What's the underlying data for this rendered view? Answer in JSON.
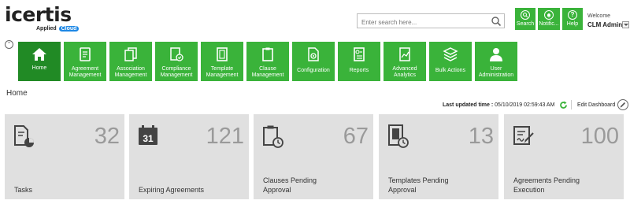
{
  "brand": {
    "name": "icertis",
    "tagline": "Applied",
    "cloud": "Cloud"
  },
  "search": {
    "placeholder": "Enter search here..."
  },
  "top_buttons": [
    {
      "label": "Search"
    },
    {
      "label": "Notific..."
    },
    {
      "label": "Help"
    }
  ],
  "user": {
    "welcome": "Welcome",
    "name": "CLM Admin"
  },
  "nav": [
    {
      "label1": "Home",
      "label2": ""
    },
    {
      "label1": "Agreement",
      "label2": "Management"
    },
    {
      "label1": "Association",
      "label2": "Management"
    },
    {
      "label1": "Compliance",
      "label2": "Management"
    },
    {
      "label1": "Template",
      "label2": "Management"
    },
    {
      "label1": "Clause",
      "label2": "Management"
    },
    {
      "label1": "Configuration",
      "label2": ""
    },
    {
      "label1": "Reports",
      "label2": ""
    },
    {
      "label1": "Advanced",
      "label2": "Analytics"
    },
    {
      "label1": "Bulk Actions",
      "label2": ""
    },
    {
      "label1": "User",
      "label2": "Administration"
    }
  ],
  "page": {
    "title": "Home"
  },
  "status": {
    "last_updated_label": "Last updated time :",
    "last_updated_value": "05/10/2019 02:59:43 AM",
    "edit_dashboard": "Edit Dashboard"
  },
  "cards": [
    {
      "count": "32",
      "line1": "Tasks",
      "line2": ""
    },
    {
      "count": "121",
      "line1": "Expiring Agreements",
      "line2": ""
    },
    {
      "count": "67",
      "line1": "Clauses Pending",
      "line2": "Approval"
    },
    {
      "count": "13",
      "line1": "Templates Pending",
      "line2": "Approval"
    },
    {
      "count": "100",
      "line1": "Agreements Pending",
      "line2": "Execution"
    }
  ],
  "calendar_day": "31",
  "colors": {
    "accent": "#3ab33a",
    "accent_active": "#218a25",
    "card_bg": "#e0e0e0",
    "count_text": "#9a9a9a"
  }
}
